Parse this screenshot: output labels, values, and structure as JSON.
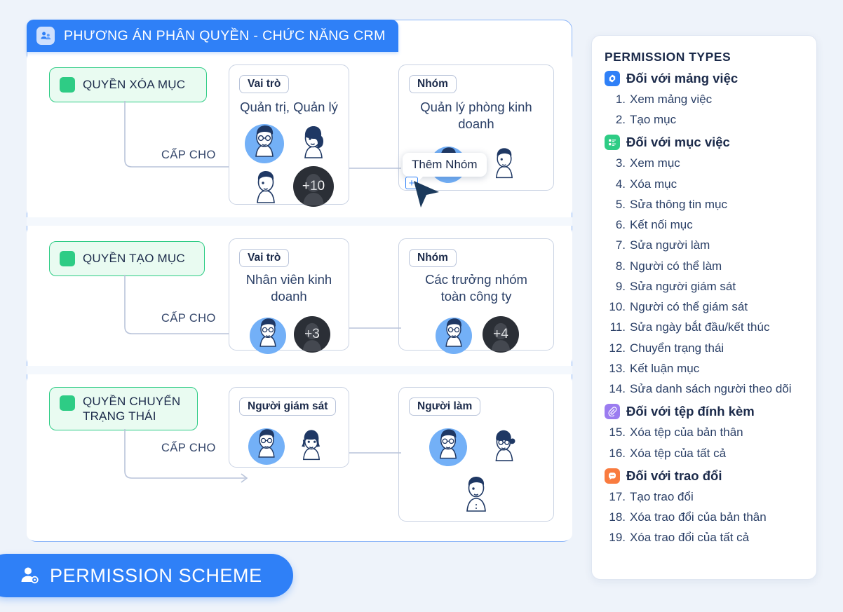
{
  "header": {
    "icon": "users-group-icon",
    "title": "PHƯƠNG ÁN PHÂN QUYỀN - CHỨC NĂNG CRM"
  },
  "diagram": {
    "grant_label": "CẤP CHO",
    "rows": [
      {
        "permission": "QUYỀN XÓA MỤC",
        "cards": [
          {
            "tag": "Vai trò",
            "title": "Quản trị, Quản lý",
            "avatars": [
              "man-glasses-highlight",
              "woman-ponytail",
              "man-short-hair"
            ],
            "overflow_badge": "+10"
          },
          {
            "tag": "Nhóm",
            "title": "Quản lý phòng kinh doanh",
            "avatars": [
              "man-glasses-highlight",
              "man-short-hair"
            ],
            "overflow_badge": ""
          }
        ]
      },
      {
        "permission": "QUYỀN TẠO MỤC",
        "cards": [
          {
            "tag": "Vai trò",
            "title": "Nhân viên kinh doanh",
            "avatars": [
              "man-glasses-highlight"
            ],
            "overflow_badge": "+3"
          },
          {
            "tag": "Nhóm",
            "title": "Các trưởng nhóm toàn công ty",
            "avatars": [
              "man-glasses-highlight"
            ],
            "overflow_badge": "+4"
          }
        ]
      },
      {
        "permission": "QUYỀN CHUYỂN TRẠNG THÁI",
        "cards": [
          {
            "tag": "Người giám sát",
            "title": "",
            "avatars": [
              "man-glasses-highlight",
              "woman-bob-hair"
            ],
            "overflow_badge": ""
          },
          {
            "tag": "Người làm",
            "title": "",
            "avatars": [
              "man-glasses-highlight",
              "woman-bun-glasses",
              "man-short-hair"
            ],
            "overflow_badge": ""
          }
        ]
      }
    ]
  },
  "tooltip": {
    "label": "Thêm Nhóm",
    "add_button": "+"
  },
  "permission_types": {
    "title": "PERMISSION TYPES",
    "groups": [
      {
        "icon": "work-area-icon",
        "icon_color": "#2f80f7",
        "label": "Đối với mảng việc",
        "items": [
          {
            "num": "1.",
            "text": "Xem mảng việc"
          },
          {
            "num": "2.",
            "text": "Tạo mục"
          }
        ]
      },
      {
        "icon": "task-list-icon",
        "icon_color": "#2ecc85",
        "label": "Đối với mục việc",
        "items": [
          {
            "num": "3.",
            "text": "Xem mục"
          },
          {
            "num": "4.",
            "text": "Xóa mục"
          },
          {
            "num": "5.",
            "text": "Sửa thông tin mục"
          },
          {
            "num": "6.",
            "text": "Kết nối mục"
          },
          {
            "num": "7.",
            "text": "Sửa người làm"
          },
          {
            "num": "8.",
            "text": "Người có thể làm"
          },
          {
            "num": "9.",
            "text": "Sửa người giám sát"
          },
          {
            "num": "10.",
            "text": "Người có thể giám sát"
          },
          {
            "num": "11.",
            "text": "Sửa ngày bắt đầu/kết thúc"
          },
          {
            "num": "12.",
            "text": "Chuyển trạng thái"
          },
          {
            "num": "13.",
            "text": "Kết luận mục"
          },
          {
            "num": "14.",
            "text": "Sửa danh sách người theo dõi"
          }
        ]
      },
      {
        "icon": "paperclip-icon",
        "icon_color": "#9b7cf0",
        "label": "Đối với tệp đính kèm",
        "items": [
          {
            "num": "15.",
            "text": "Xóa tệp của bản thân"
          },
          {
            "num": "16.",
            "text": "Xóa tệp của tất cả"
          }
        ]
      },
      {
        "icon": "chat-bubble-icon",
        "icon_color": "#f97b3f",
        "label": "Đối với trao đổi",
        "items": [
          {
            "num": "17.",
            "text": "Tạo trao đổi"
          },
          {
            "num": "18.",
            "text": "Xóa trao đổi của bản thân"
          },
          {
            "num": "19.",
            "text": "Xóa trao đổi của tất cả"
          }
        ]
      }
    ]
  },
  "bottom_banner": {
    "icon": "user-settings-icon",
    "label": "PERMISSION SCHEME"
  },
  "colors": {
    "background": "#eef3fa",
    "brand_blue": "#2f80f7",
    "accent_green": "#2ecc85",
    "panel_border": "#8ab4f8",
    "text_dark": "#1b2a4a"
  }
}
